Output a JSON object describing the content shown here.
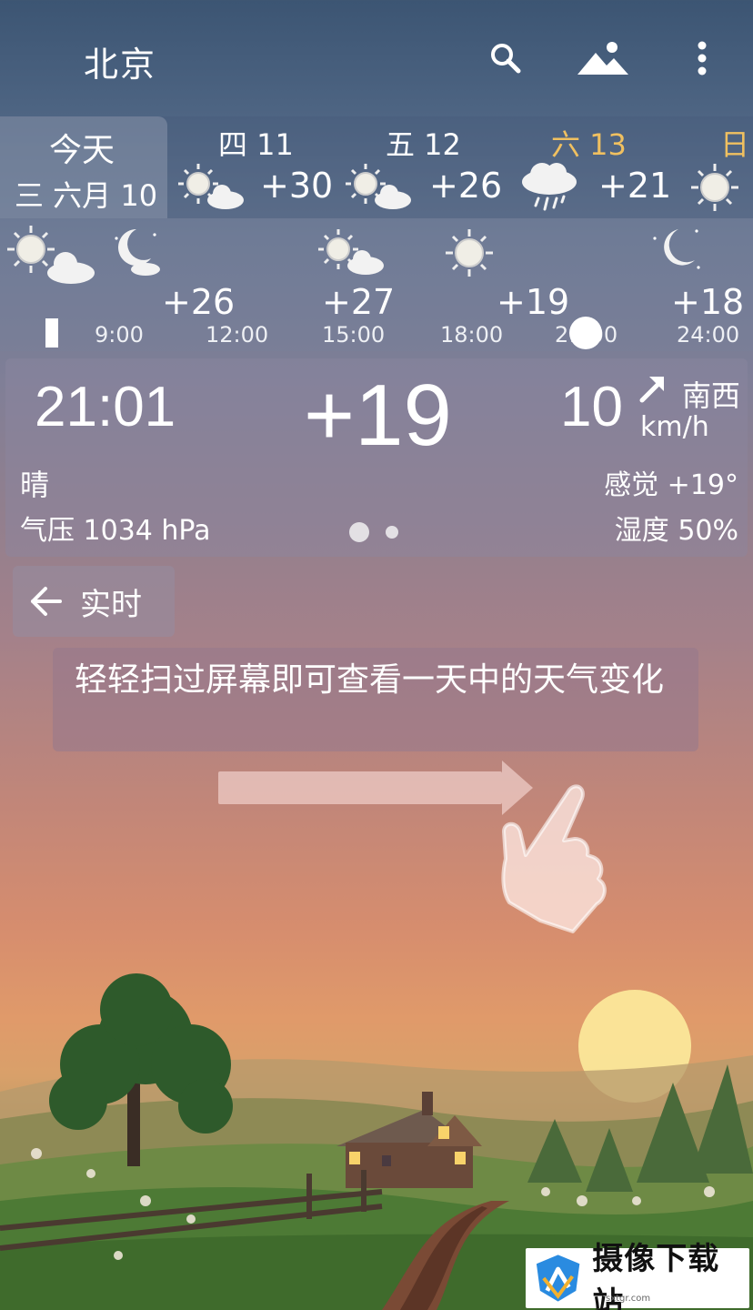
{
  "header": {
    "city": "北京",
    "search_icon": "search-icon",
    "scene_icon": "landscape-icon",
    "menu_icon": "more-vert-icon"
  },
  "days": [
    {
      "name": "今天",
      "date": "三 六月 10"
    },
    {
      "name": "四 11",
      "temp": "+30",
      "icon": "sun-cloud-icon"
    },
    {
      "name": "五 12",
      "temp": "+26",
      "icon": "sun-cloud-icon"
    },
    {
      "name": "六 13",
      "temp": "+21",
      "icon": "rain-cloud-icon",
      "highlight": "#f0c060"
    },
    {
      "name": "日",
      "icon": "sun-icon",
      "highlight": "#f0c060"
    }
  ],
  "hourly": {
    "temps": [
      "+26",
      "+27",
      "+19",
      "+18"
    ],
    "times": [
      "9:00",
      "12:00",
      "15:00",
      "18:00",
      "21:00",
      "24:00"
    ]
  },
  "current": {
    "time": "21:01",
    "temp": "+19",
    "wind_speed": "10",
    "wind_unit": "km/h",
    "wind_dir": "南西",
    "condition": "晴",
    "pressure": "气压 1034 hPa",
    "feels_like": "感觉 +19°",
    "humidity": "湿度 50%"
  },
  "realtime": {
    "label": "实时"
  },
  "hint": {
    "text": "轻轻扫过屏幕即可查看一天中的天气变化"
  },
  "watermark": {
    "text": "摄像下载站",
    "sub": "sxtgr.com"
  },
  "colors": {
    "weekend": "#f0c060",
    "sun": "#f4f1e8"
  }
}
